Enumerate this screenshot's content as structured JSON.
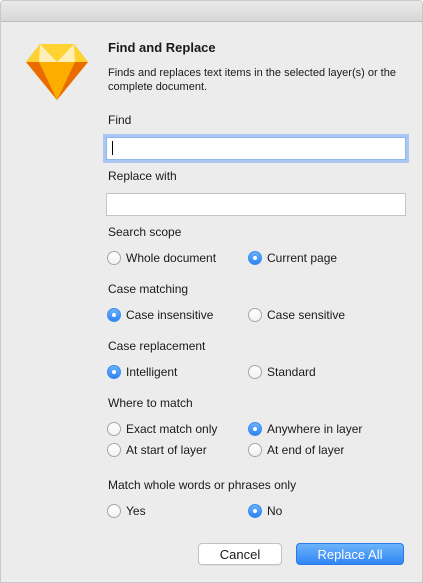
{
  "dialog": {
    "title": "Find and Replace",
    "description": "Finds and replaces text items in the selected layer(s) or the complete document.",
    "icon": "sketch-diamond-icon"
  },
  "find": {
    "label": "Find",
    "value": ""
  },
  "replace": {
    "label": "Replace with",
    "value": ""
  },
  "search_scope": {
    "label": "Search scope",
    "options": [
      "Whole document",
      "Current page"
    ],
    "selected": "Current page"
  },
  "case_matching": {
    "label": "Case matching",
    "options": [
      "Case insensitive",
      "Case sensitive"
    ],
    "selected": "Case insensitive"
  },
  "case_replacement": {
    "label": "Case replacement",
    "options": [
      "Intelligent",
      "Standard"
    ],
    "selected": "Intelligent"
  },
  "where_to_match": {
    "label": "Where to match",
    "options": [
      "Exact match only",
      "Anywhere in layer",
      "At start of layer",
      "At end of layer"
    ],
    "selected": "Anywhere in layer"
  },
  "whole_words": {
    "label": "Match whole words or phrases only",
    "options": [
      "Yes",
      "No"
    ],
    "selected": "No"
  },
  "buttons": {
    "cancel": "Cancel",
    "primary": "Replace All"
  },
  "colors": {
    "accent": "#2f86f5",
    "window_bg": "#ececec",
    "focus_ring": "#aac8f3"
  }
}
